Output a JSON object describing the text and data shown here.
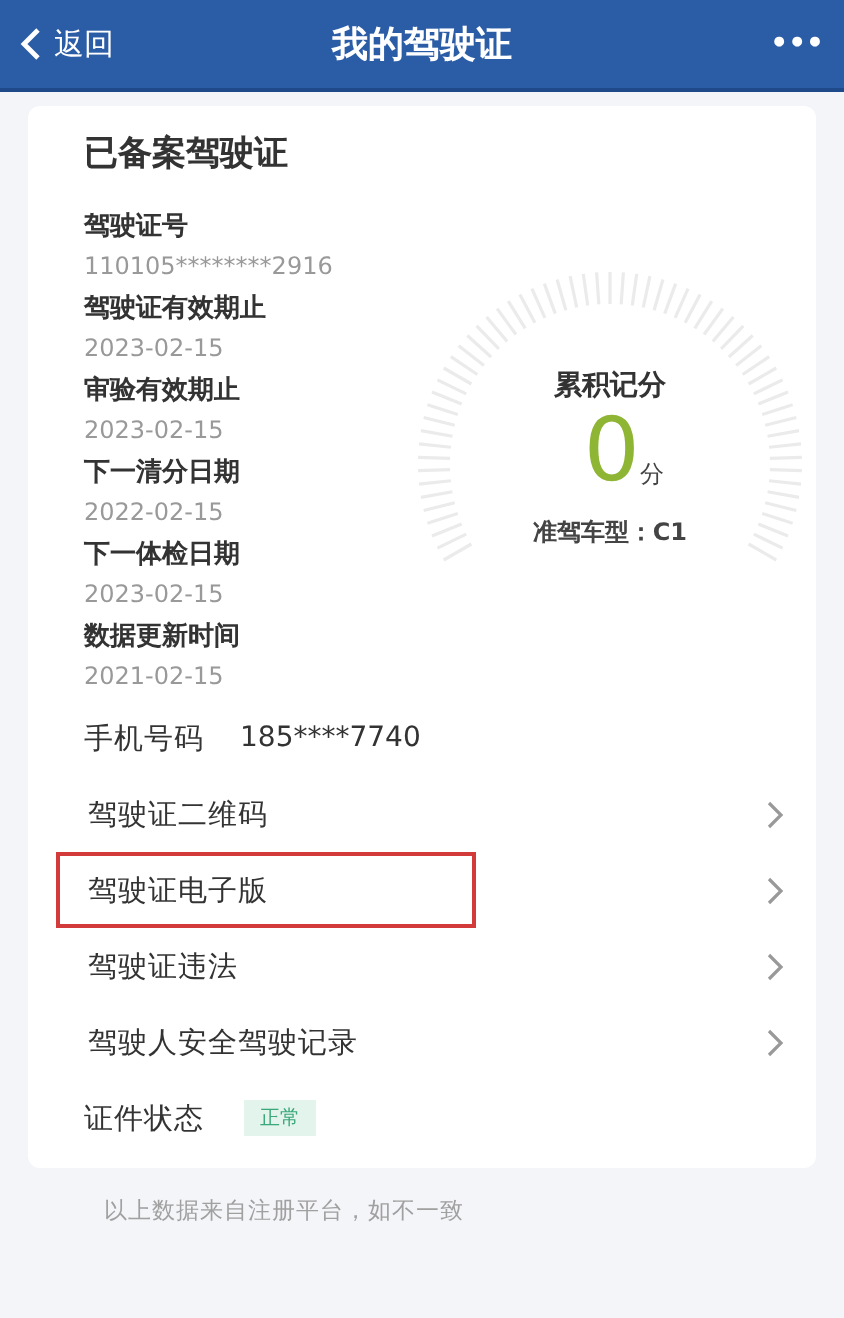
{
  "header": {
    "back_label": "返回",
    "title": "我的驾驶证",
    "more": "•••"
  },
  "card": {
    "title": "已备案驾驶证",
    "fields": [
      {
        "label": "驾驶证号",
        "value": "110105********2916"
      },
      {
        "label": "驾驶证有效期止",
        "value": "2023-02-15"
      },
      {
        "label": "审验有效期止",
        "value": "2023-02-15"
      },
      {
        "label": "下一清分日期",
        "value": "2022-02-15"
      },
      {
        "label": "下一体检日期",
        "value": "2023-02-15"
      },
      {
        "label": "数据更新时间",
        "value": "2021-02-15"
      }
    ],
    "score": {
      "label": "累积记分",
      "value": "0",
      "unit": "分",
      "class_label": "准驾车型：C1"
    },
    "phone": {
      "label": "手机号码",
      "value": "185****7740"
    },
    "menu": [
      {
        "label": "驾驶证二维码",
        "highlighted": false
      },
      {
        "label": "驾驶证电子版",
        "highlighted": true
      },
      {
        "label": "驾驶证违法",
        "highlighted": false
      },
      {
        "label": "驾驶人安全驾驶记录",
        "highlighted": false
      }
    ],
    "status": {
      "label": "证件状态",
      "badge": "正常"
    }
  },
  "footer": "以上数据来自注册平台，如不一致"
}
